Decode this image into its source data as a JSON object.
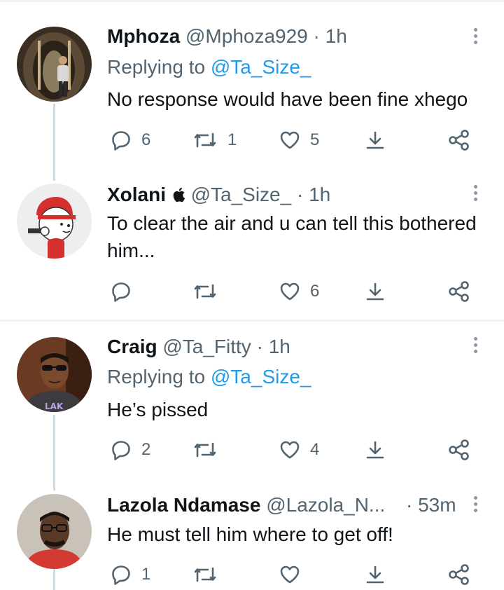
{
  "tweets": [
    {
      "name": "Mphoza",
      "handle": "@Mphoza929",
      "time": "1h",
      "replying_prefix": "Replying to",
      "replying_to": "@Ta_Size_",
      "text": "No response would have been fine xhego",
      "replies": "6",
      "retweets": "1",
      "likes": "5"
    },
    {
      "name": "Xolani",
      "handle": "@Ta_Size_",
      "time": "1h",
      "text": "To clear the air and u can tell this bothered him...",
      "replies": "",
      "retweets": "",
      "likes": "6"
    },
    {
      "name": "Craig",
      "handle": "@Ta_Fitty",
      "time": "1h",
      "replying_prefix": "Replying to",
      "replying_to": "@Ta_Size_",
      "text": "He’s pissed",
      "replies": "2",
      "retweets": "",
      "likes": "4"
    },
    {
      "name": "Lazola Ndamase",
      "handle": "@Lazola_N...",
      "time": "53m",
      "text": "He must tell him where to get off!",
      "replies": "1",
      "retweets": "",
      "likes": ""
    }
  ],
  "separator": "·",
  "icons": {
    "reply": "reply-icon",
    "retweet": "retweet-icon",
    "like": "like-icon",
    "share": "share-icon",
    "download": "download-icon",
    "more": "more-icon",
    "verified_emoji": "apple-icon"
  },
  "colors": {
    "link": "#1d9bf0",
    "secondary": "#536471",
    "thread_line": "#cfd9de",
    "divider": "#eff3f4"
  }
}
